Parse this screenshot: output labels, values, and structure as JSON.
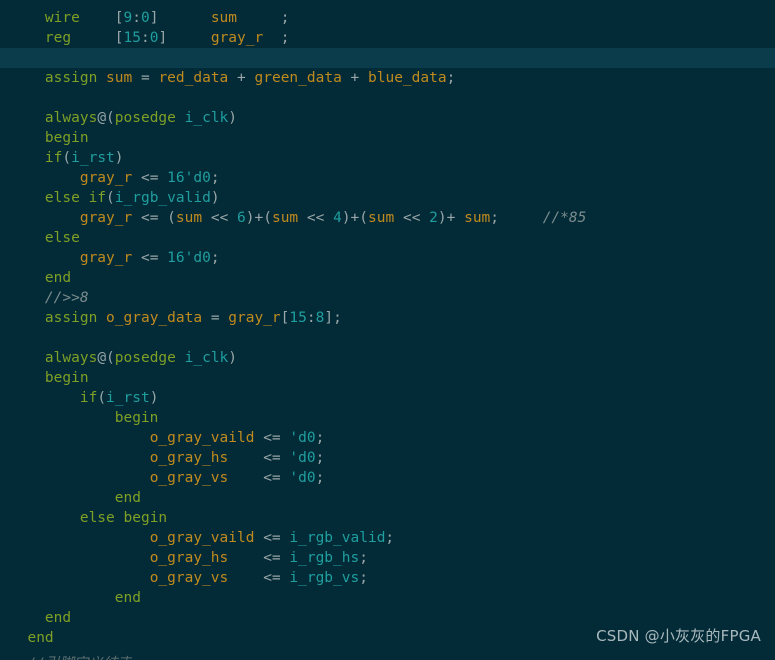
{
  "editor": {
    "language": "verilog",
    "background_color": "#022b37",
    "active_line_color": "#0a3c4b",
    "active_line_index": 2,
    "colors": {
      "keyword": "#7f9f25",
      "identifier": "#c08a1e",
      "number": "#1f9e9e",
      "comment": "#7c8c8e",
      "punctuation": "#9aa6a8"
    },
    "lines": [
      {
        "index": 0,
        "text": "    wire    [9:0]      sum     ;",
        "tokens": [
          {
            "t": "    ",
            "c": "plain"
          },
          {
            "t": "wire",
            "c": "keyword"
          },
          {
            "t": "    ",
            "c": "plain"
          },
          {
            "t": "[",
            "c": "bracket"
          },
          {
            "t": "9",
            "c": "number"
          },
          {
            "t": ":",
            "c": "op"
          },
          {
            "t": "0",
            "c": "number"
          },
          {
            "t": "]",
            "c": "bracket"
          },
          {
            "t": "      ",
            "c": "plain"
          },
          {
            "t": "sum",
            "c": "ident"
          },
          {
            "t": "     ",
            "c": "plain"
          },
          {
            "t": ";",
            "c": "op"
          }
        ]
      },
      {
        "index": 1,
        "text": "    reg     [15:0]     gray_r  ;",
        "tokens": [
          {
            "t": "    ",
            "c": "plain"
          },
          {
            "t": "reg",
            "c": "keyword"
          },
          {
            "t": "     ",
            "c": "plain"
          },
          {
            "t": "[",
            "c": "bracket"
          },
          {
            "t": "15",
            "c": "number"
          },
          {
            "t": ":",
            "c": "op"
          },
          {
            "t": "0",
            "c": "number"
          },
          {
            "t": "]",
            "c": "bracket"
          },
          {
            "t": "     ",
            "c": "plain"
          },
          {
            "t": "gray_r",
            "c": "ident"
          },
          {
            "t": "  ",
            "c": "plain"
          },
          {
            "t": ";",
            "c": "op"
          }
        ]
      },
      {
        "index": 2,
        "text": "",
        "tokens": []
      },
      {
        "index": 3,
        "text": "    assign sum = red_data + green_data + blue_data;",
        "tokens": [
          {
            "t": "    ",
            "c": "plain"
          },
          {
            "t": "assign",
            "c": "keyword"
          },
          {
            "t": " ",
            "c": "plain"
          },
          {
            "t": "sum",
            "c": "ident"
          },
          {
            "t": " ",
            "c": "plain"
          },
          {
            "t": "=",
            "c": "op"
          },
          {
            "t": " ",
            "c": "plain"
          },
          {
            "t": "red_data",
            "c": "ident"
          },
          {
            "t": " ",
            "c": "plain"
          },
          {
            "t": "+",
            "c": "op"
          },
          {
            "t": " ",
            "c": "plain"
          },
          {
            "t": "green_data",
            "c": "ident"
          },
          {
            "t": " ",
            "c": "plain"
          },
          {
            "t": "+",
            "c": "op"
          },
          {
            "t": " ",
            "c": "plain"
          },
          {
            "t": "blue_data",
            "c": "ident"
          },
          {
            "t": ";",
            "c": "op"
          }
        ]
      },
      {
        "index": 4,
        "text": "",
        "tokens": []
      },
      {
        "index": 5,
        "text": "    always@(posedge i_clk)",
        "tokens": [
          {
            "t": "    ",
            "c": "plain"
          },
          {
            "t": "always",
            "c": "keyword"
          },
          {
            "t": "@(",
            "c": "op"
          },
          {
            "t": "posedge",
            "c": "keyword"
          },
          {
            "t": " ",
            "c": "plain"
          },
          {
            "t": "i_clk",
            "c": "number"
          },
          {
            "t": ")",
            "c": "op"
          }
        ]
      },
      {
        "index": 6,
        "text": "    begin",
        "tokens": [
          {
            "t": "    ",
            "c": "plain"
          },
          {
            "t": "begin",
            "c": "keyword"
          }
        ]
      },
      {
        "index": 7,
        "text": "    if(i_rst)",
        "tokens": [
          {
            "t": "    ",
            "c": "plain"
          },
          {
            "t": "if",
            "c": "keyword"
          },
          {
            "t": "(",
            "c": "op"
          },
          {
            "t": "i_rst",
            "c": "number"
          },
          {
            "t": ")",
            "c": "op"
          }
        ]
      },
      {
        "index": 8,
        "text": "        gray_r <= 16'd0;",
        "tokens": [
          {
            "t": "        ",
            "c": "plain"
          },
          {
            "t": "gray_r",
            "c": "ident"
          },
          {
            "t": " ",
            "c": "plain"
          },
          {
            "t": "<=",
            "c": "op"
          },
          {
            "t": " ",
            "c": "plain"
          },
          {
            "t": "16'd0",
            "c": "number"
          },
          {
            "t": ";",
            "c": "op"
          }
        ]
      },
      {
        "index": 9,
        "text": "    else if(i_rgb_valid)",
        "tokens": [
          {
            "t": "    ",
            "c": "plain"
          },
          {
            "t": "else",
            "c": "keyword"
          },
          {
            "t": " ",
            "c": "plain"
          },
          {
            "t": "if",
            "c": "keyword"
          },
          {
            "t": "(",
            "c": "op"
          },
          {
            "t": "i_rgb_valid",
            "c": "number"
          },
          {
            "t": ")",
            "c": "op"
          }
        ]
      },
      {
        "index": 10,
        "text": "        gray_r <= (sum << 6)+(sum << 4)+(sum << 2)+ sum;     //*85",
        "tokens": [
          {
            "t": "        ",
            "c": "plain"
          },
          {
            "t": "gray_r",
            "c": "ident"
          },
          {
            "t": " ",
            "c": "plain"
          },
          {
            "t": "<=",
            "c": "op"
          },
          {
            "t": " (",
            "c": "op"
          },
          {
            "t": "sum",
            "c": "ident"
          },
          {
            "t": " << ",
            "c": "op"
          },
          {
            "t": "6",
            "c": "number"
          },
          {
            "t": ")+(",
            "c": "op"
          },
          {
            "t": "sum",
            "c": "ident"
          },
          {
            "t": " << ",
            "c": "op"
          },
          {
            "t": "4",
            "c": "number"
          },
          {
            "t": ")+(",
            "c": "op"
          },
          {
            "t": "sum",
            "c": "ident"
          },
          {
            "t": " << ",
            "c": "op"
          },
          {
            "t": "2",
            "c": "number"
          },
          {
            "t": ")+ ",
            "c": "op"
          },
          {
            "t": "sum",
            "c": "ident"
          },
          {
            "t": ";",
            "c": "op"
          },
          {
            "t": "     ",
            "c": "plain"
          },
          {
            "t": "//*85",
            "c": "comment"
          }
        ]
      },
      {
        "index": 11,
        "text": "    else",
        "tokens": [
          {
            "t": "    ",
            "c": "plain"
          },
          {
            "t": "else",
            "c": "keyword"
          }
        ]
      },
      {
        "index": 12,
        "text": "        gray_r <= 16'd0;",
        "tokens": [
          {
            "t": "        ",
            "c": "plain"
          },
          {
            "t": "gray_r",
            "c": "ident"
          },
          {
            "t": " ",
            "c": "plain"
          },
          {
            "t": "<=",
            "c": "op"
          },
          {
            "t": " ",
            "c": "plain"
          },
          {
            "t": "16'd0",
            "c": "number"
          },
          {
            "t": ";",
            "c": "op"
          }
        ]
      },
      {
        "index": 13,
        "text": "    end",
        "tokens": [
          {
            "t": "    ",
            "c": "plain"
          },
          {
            "t": "end",
            "c": "keyword"
          }
        ]
      },
      {
        "index": 14,
        "text": "    //>>8",
        "tokens": [
          {
            "t": "    ",
            "c": "plain"
          },
          {
            "t": "//>>8",
            "c": "comment"
          }
        ]
      },
      {
        "index": 15,
        "text": "    assign o_gray_data = gray_r[15:8];",
        "tokens": [
          {
            "t": "    ",
            "c": "plain"
          },
          {
            "t": "assign",
            "c": "keyword"
          },
          {
            "t": " ",
            "c": "plain"
          },
          {
            "t": "o_gray_data",
            "c": "ident"
          },
          {
            "t": " ",
            "c": "plain"
          },
          {
            "t": "=",
            "c": "op"
          },
          {
            "t": " ",
            "c": "plain"
          },
          {
            "t": "gray_r",
            "c": "ident"
          },
          {
            "t": "[",
            "c": "bracket"
          },
          {
            "t": "15",
            "c": "number"
          },
          {
            "t": ":",
            "c": "op"
          },
          {
            "t": "8",
            "c": "number"
          },
          {
            "t": "]",
            "c": "bracket"
          },
          {
            "t": ";",
            "c": "op"
          }
        ]
      },
      {
        "index": 16,
        "text": "",
        "tokens": []
      },
      {
        "index": 17,
        "text": "    always@(posedge i_clk)",
        "tokens": [
          {
            "t": "    ",
            "c": "plain"
          },
          {
            "t": "always",
            "c": "keyword"
          },
          {
            "t": "@(",
            "c": "op"
          },
          {
            "t": "posedge",
            "c": "keyword"
          },
          {
            "t": " ",
            "c": "plain"
          },
          {
            "t": "i_clk",
            "c": "number"
          },
          {
            "t": ")",
            "c": "op"
          }
        ]
      },
      {
        "index": 18,
        "text": "    begin",
        "tokens": [
          {
            "t": "    ",
            "c": "plain"
          },
          {
            "t": "begin",
            "c": "keyword"
          }
        ]
      },
      {
        "index": 19,
        "text": "        if(i_rst)",
        "tokens": [
          {
            "t": "        ",
            "c": "plain"
          },
          {
            "t": "if",
            "c": "keyword"
          },
          {
            "t": "(",
            "c": "op"
          },
          {
            "t": "i_rst",
            "c": "number"
          },
          {
            "t": ")",
            "c": "op"
          }
        ]
      },
      {
        "index": 20,
        "text": "            begin",
        "tokens": [
          {
            "t": "            ",
            "c": "plain"
          },
          {
            "t": "begin",
            "c": "keyword"
          }
        ]
      },
      {
        "index": 21,
        "text": "                o_gray_vaild <= 'd0;",
        "tokens": [
          {
            "t": "                ",
            "c": "plain"
          },
          {
            "t": "o_gray_vaild",
            "c": "ident"
          },
          {
            "t": " ",
            "c": "plain"
          },
          {
            "t": "<=",
            "c": "op"
          },
          {
            "t": " ",
            "c": "plain"
          },
          {
            "t": "'d0",
            "c": "number"
          },
          {
            "t": ";",
            "c": "op"
          }
        ]
      },
      {
        "index": 22,
        "text": "                o_gray_hs    <= 'd0;",
        "tokens": [
          {
            "t": "                ",
            "c": "plain"
          },
          {
            "t": "o_gray_hs",
            "c": "ident"
          },
          {
            "t": "    ",
            "c": "plain"
          },
          {
            "t": "<=",
            "c": "op"
          },
          {
            "t": " ",
            "c": "plain"
          },
          {
            "t": "'d0",
            "c": "number"
          },
          {
            "t": ";",
            "c": "op"
          }
        ]
      },
      {
        "index": 23,
        "text": "                o_gray_vs    <= 'd0;",
        "tokens": [
          {
            "t": "                ",
            "c": "plain"
          },
          {
            "t": "o_gray_vs",
            "c": "ident"
          },
          {
            "t": "    ",
            "c": "plain"
          },
          {
            "t": "<=",
            "c": "op"
          },
          {
            "t": " ",
            "c": "plain"
          },
          {
            "t": "'d0",
            "c": "number"
          },
          {
            "t": ";",
            "c": "op"
          }
        ]
      },
      {
        "index": 24,
        "text": "            end",
        "tokens": [
          {
            "t": "            ",
            "c": "plain"
          },
          {
            "t": "end",
            "c": "keyword"
          }
        ]
      },
      {
        "index": 25,
        "text": "        else begin",
        "tokens": [
          {
            "t": "        ",
            "c": "plain"
          },
          {
            "t": "else",
            "c": "keyword"
          },
          {
            "t": " ",
            "c": "plain"
          },
          {
            "t": "begin",
            "c": "keyword"
          }
        ]
      },
      {
        "index": 26,
        "text": "                o_gray_vaild <= i_rgb_valid;",
        "tokens": [
          {
            "t": "                ",
            "c": "plain"
          },
          {
            "t": "o_gray_vaild",
            "c": "ident"
          },
          {
            "t": " ",
            "c": "plain"
          },
          {
            "t": "<=",
            "c": "op"
          },
          {
            "t": " ",
            "c": "plain"
          },
          {
            "t": "i_rgb_valid",
            "c": "number"
          },
          {
            "t": ";",
            "c": "op"
          }
        ]
      },
      {
        "index": 27,
        "text": "                o_gray_hs    <= i_rgb_hs;",
        "tokens": [
          {
            "t": "                ",
            "c": "plain"
          },
          {
            "t": "o_gray_hs",
            "c": "ident"
          },
          {
            "t": "    ",
            "c": "plain"
          },
          {
            "t": "<=",
            "c": "op"
          },
          {
            "t": " ",
            "c": "plain"
          },
          {
            "t": "i_rgb_hs",
            "c": "number"
          },
          {
            "t": ";",
            "c": "op"
          }
        ]
      },
      {
        "index": 28,
        "text": "                o_gray_vs    <= i_rgb_vs;",
        "tokens": [
          {
            "t": "                ",
            "c": "plain"
          },
          {
            "t": "o_gray_vs",
            "c": "ident"
          },
          {
            "t": "    ",
            "c": "plain"
          },
          {
            "t": "<=",
            "c": "op"
          },
          {
            "t": " ",
            "c": "plain"
          },
          {
            "t": "i_rgb_vs",
            "c": "number"
          },
          {
            "t": ";",
            "c": "op"
          }
        ]
      },
      {
        "index": 29,
        "text": "            end",
        "tokens": [
          {
            "t": "            ",
            "c": "plain"
          },
          {
            "t": "end",
            "c": "keyword"
          }
        ]
      },
      {
        "index": 30,
        "text": "    end",
        "tokens": [
          {
            "t": "    ",
            "c": "plain"
          },
          {
            "t": "end",
            "c": "keyword"
          }
        ]
      },
      {
        "index": 31,
        "text": "  end",
        "tokens": [
          {
            "t": "  ",
            "c": "plain"
          },
          {
            "t": "end",
            "c": "keyword"
          }
        ]
      }
    ],
    "clipped_bottom_line": "  //引脚定义结束"
  },
  "watermark": {
    "text": "CSDN @小灰灰的FPGA"
  }
}
